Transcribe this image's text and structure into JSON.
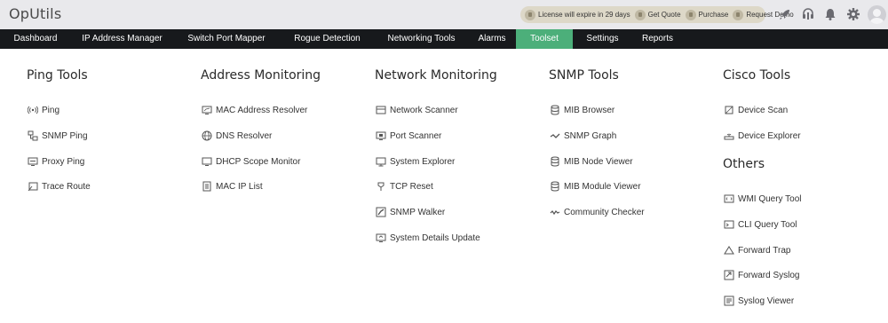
{
  "app": {
    "title": "OpUtils"
  },
  "promo": {
    "license": "License will expire in 29 days",
    "get_quote": "Get Quote",
    "purchase": "Purchase",
    "request_demo": "Request Demo"
  },
  "header_icons": [
    "rocket-icon",
    "headset-icon",
    "bell-icon",
    "gear-icon",
    "avatar"
  ],
  "nav": {
    "active": "Toolset",
    "items": [
      "Dashboard",
      "IP Address Manager",
      "Switch Port Mapper",
      "Rogue Detection",
      "Networking Tools",
      "Alarms",
      "Toolset",
      "Settings",
      "Reports"
    ]
  },
  "colors": {
    "nav_bg": "#17191c",
    "active_tab": "#4caf7a",
    "header_bg": "#e9e9ec"
  },
  "sections": {
    "ping_tools": {
      "title": "Ping Tools",
      "items": [
        "Ping",
        "SNMP Ping",
        "Proxy Ping",
        "Trace Route"
      ]
    },
    "address_monitoring": {
      "title": "Address Monitoring",
      "items": [
        "MAC Address Resolver",
        "DNS Resolver",
        "DHCP Scope Monitor",
        "MAC IP List"
      ]
    },
    "network_monitoring": {
      "title": "Network Monitoring",
      "items": [
        "Network Scanner",
        "Port Scanner",
        "System Explorer",
        "TCP Reset",
        "SNMP Walker",
        "System Details Update"
      ]
    },
    "snmp_tools": {
      "title": "SNMP Tools",
      "items": [
        "MIB Browser",
        "SNMP Graph",
        "MIB Node Viewer",
        "MIB Module Viewer",
        "Community Checker"
      ]
    },
    "cisco_tools": {
      "title": "Cisco Tools",
      "items": [
        "Device Scan",
        "Device Explorer"
      ]
    },
    "others": {
      "title": "Others",
      "items": [
        "WMI Query Tool",
        "CLI Query Tool",
        "Forward Trap",
        "Forward Syslog",
        "Syslog Viewer"
      ]
    }
  }
}
